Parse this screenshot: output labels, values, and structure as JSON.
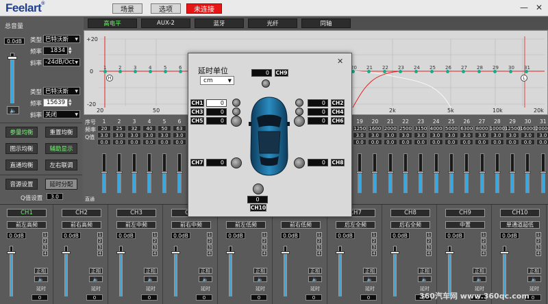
{
  "titlebar": {
    "logo": "Feelart",
    "logo_reg": "®",
    "btn_scene": "场景",
    "btn_options": "选项",
    "btn_connect": "未连接",
    "win_min": "—",
    "win_close": "✕"
  },
  "left": {
    "master_volume_label": "总音量",
    "master_db": "0.0dB",
    "hp": {
      "type_label": "类型",
      "type_value": "巴特沃斯",
      "freq_label": "频率",
      "freq_value": "1834",
      "slope_label": "斜率",
      "slope_value": "-24dB/Oct"
    },
    "lp": {
      "type_label": "类型",
      "type_value": "巴特沃斯",
      "freq_label": "频率",
      "freq_value": "15639",
      "slope_label": "斜率",
      "slope_value": "关闭"
    },
    "btns": {
      "param_eq": "参量均衡",
      "reset_eq": "重置均衡",
      "graphic_eq": "图示均衡",
      "aux_display": "辅助显示",
      "direct_eq": "直通均衡",
      "lr_link": "左右联调",
      "source_settings": "音源设置",
      "delay_assign": "延时分配"
    },
    "q_label": "Q值设置",
    "q_value": "3.0"
  },
  "sources": [
    "高电平",
    "AUX-2",
    "蓝牙",
    "光纤",
    "同轴"
  ],
  "active_source": 0,
  "graph": {
    "y_ticks": [
      "+20",
      "0",
      "-20"
    ],
    "x_ticks": [
      "20",
      "50",
      "2k",
      "5k",
      "10k",
      "20k"
    ],
    "marker_h": "H",
    "marker_l": "L",
    "point_labels_left": [
      "1",
      "2",
      "3",
      "4",
      "5",
      "6"
    ],
    "point_labels_right": [
      "20",
      "21",
      "22",
      "23",
      "24",
      "25",
      "26",
      "27",
      "28",
      "29",
      "30",
      "31"
    ],
    "accent": "#e32020",
    "point_color": "#1aa88a"
  },
  "eq": {
    "row_label_num": "序号",
    "row_label_freq": "频率",
    "row_label_q": "Q值",
    "row_label_direct": "直通",
    "left_bands": [
      {
        "n": "1",
        "f": "20",
        "q1": "3.0",
        "q2": "0.0"
      },
      {
        "n": "2",
        "f": "25",
        "q1": "3.0",
        "q2": "0.0"
      },
      {
        "n": "3",
        "f": "32",
        "q1": "3.0",
        "q2": "0.0"
      },
      {
        "n": "4",
        "f": "40",
        "q1": "3.0",
        "q2": "0.0"
      },
      {
        "n": "5",
        "f": "50",
        "q1": "3.0",
        "q2": "0.0"
      },
      {
        "n": "6",
        "f": "63",
        "q1": "3.0",
        "q2": "0.0"
      }
    ],
    "right_bands": [
      {
        "n": "19",
        "f": "1250",
        "q1": "3.0",
        "q2": "0.0"
      },
      {
        "n": "20",
        "f": "1600",
        "q1": "3.0",
        "q2": "0.0"
      },
      {
        "n": "21",
        "f": "2000",
        "q1": "3.0",
        "q2": "0.0"
      },
      {
        "n": "22",
        "f": "2500",
        "q1": "3.0",
        "q2": "0.0"
      },
      {
        "n": "23",
        "f": "3150",
        "q1": "3.0",
        "q2": "0.0"
      },
      {
        "n": "24",
        "f": "4000",
        "q1": "3.0",
        "q2": "0.0"
      },
      {
        "n": "25",
        "f": "5000",
        "q1": "3.0",
        "q2": "0.0"
      },
      {
        "n": "26",
        "f": "6300",
        "q1": "3.0",
        "q2": "0.0"
      },
      {
        "n": "27",
        "f": "8000",
        "q1": "3.0",
        "q2": "0.0"
      },
      {
        "n": "28",
        "f": "10000",
        "q1": "3.0",
        "q2": "0.0"
      },
      {
        "n": "29",
        "f": "12500",
        "q1": "3.0",
        "q2": "0.0"
      },
      {
        "n": "30",
        "f": "16000",
        "q1": "3.0",
        "q2": "0.0"
      },
      {
        "n": "31",
        "f": "20000",
        "q1": "3.0",
        "q2": "0.0"
      }
    ]
  },
  "channels": [
    {
      "id": "CH1",
      "pos": "前左高频",
      "db": "0.0dB",
      "phase": "正相",
      "delay_label": "延时",
      "delay": "0"
    },
    {
      "id": "CH2",
      "pos": "前右高频",
      "db": "0.0dB",
      "phase": "正相",
      "delay_label": "延时",
      "delay": "0"
    },
    {
      "id": "CH3",
      "pos": "前左中频",
      "db": "0.0dB",
      "phase": "正相",
      "delay_label": "延时",
      "delay": "0"
    },
    {
      "id": "CH4",
      "pos": "前右中频",
      "db": "0.0dB",
      "phase": "正相",
      "delay_label": "延时",
      "delay": "0"
    },
    {
      "id": "CH5",
      "pos": "前左低频",
      "db": "0.0dB",
      "phase": "正相",
      "delay_label": "延时",
      "delay": "0"
    },
    {
      "id": "CH6",
      "pos": "前右低频",
      "db": "0.0dB",
      "phase": "正相",
      "delay_label": "延时",
      "delay": "0"
    },
    {
      "id": "CH7",
      "pos": "后左全频",
      "db": "0.0dB",
      "phase": "正相",
      "delay_label": "延时",
      "delay": "0"
    },
    {
      "id": "CH8",
      "pos": "后右全频",
      "db": "0.0dB",
      "phase": "正相",
      "delay_label": "延时",
      "delay": "0"
    },
    {
      "id": "CH9",
      "pos": "中置",
      "db": "0.0dB",
      "phase": "正相",
      "delay_label": "延时",
      "delay": "0"
    },
    {
      "id": "CH10",
      "pos": "单通道超低",
      "db": "0.0dB",
      "phase": "正相",
      "delay_label": "延时",
      "delay": "0"
    }
  ],
  "active_channel": 0,
  "channel_nums": [
    "1",
    "2",
    "3",
    "4"
  ],
  "dialog": {
    "title": "延时单位",
    "close": "✕",
    "unit": "cm",
    "ch9": {
      "label": "CH9",
      "value": "0"
    },
    "ch1": {
      "label": "CH1",
      "value": "0"
    },
    "ch3": {
      "label": "CH3",
      "value": "0"
    },
    "ch5": {
      "label": "CH5",
      "value": "0"
    },
    "ch2": {
      "label": "CH2",
      "value": "0"
    },
    "ch4": {
      "label": "CH4",
      "value": "0"
    },
    "ch6": {
      "label": "CH6",
      "value": "0"
    },
    "ch7": {
      "label": "CH7",
      "value": "0"
    },
    "ch8": {
      "label": "CH8",
      "value": "0"
    },
    "ch10": {
      "label": "CH10",
      "value": "0"
    }
  },
  "watermark": "360汽车网 www.360qc.com"
}
